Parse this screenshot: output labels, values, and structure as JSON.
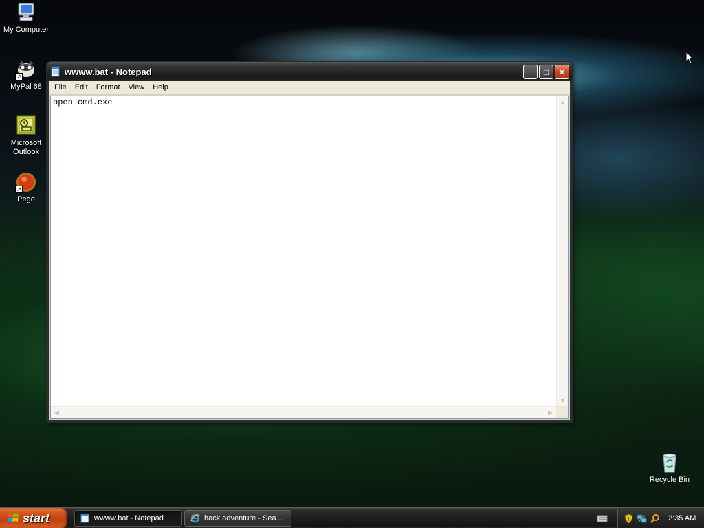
{
  "desktop": {
    "icons": [
      {
        "label": "My Computer",
        "icon": "my-computer-icon"
      },
      {
        "label": "MyPal 68",
        "icon": "mypal-icon"
      },
      {
        "label": "Microsoft Outlook",
        "icon": "outlook-icon"
      },
      {
        "label": "Pego",
        "icon": "pego-icon"
      },
      {
        "label": "Recycle Bin",
        "icon": "recycle-bin-icon"
      }
    ]
  },
  "window": {
    "title": "wwww.bat - Notepad",
    "menu": [
      "File",
      "Edit",
      "Format",
      "View",
      "Help"
    ],
    "content": "open cmd.exe",
    "buttons": {
      "minimize": "_",
      "maximize": "□",
      "close": "✕"
    }
  },
  "taskbar": {
    "start_label": "start",
    "tasks": [
      {
        "label": "wwww.bat - Notepad",
        "icon": "notepad-icon",
        "active": true
      },
      {
        "label": "hack adventure - Sea...",
        "icon": "ie-icon",
        "active": false
      }
    ],
    "clock": "2:35 AM"
  },
  "colors": {
    "start_button": "#d4541c",
    "close_button": "#c4441e",
    "taskbar": "#1f1f1f"
  }
}
